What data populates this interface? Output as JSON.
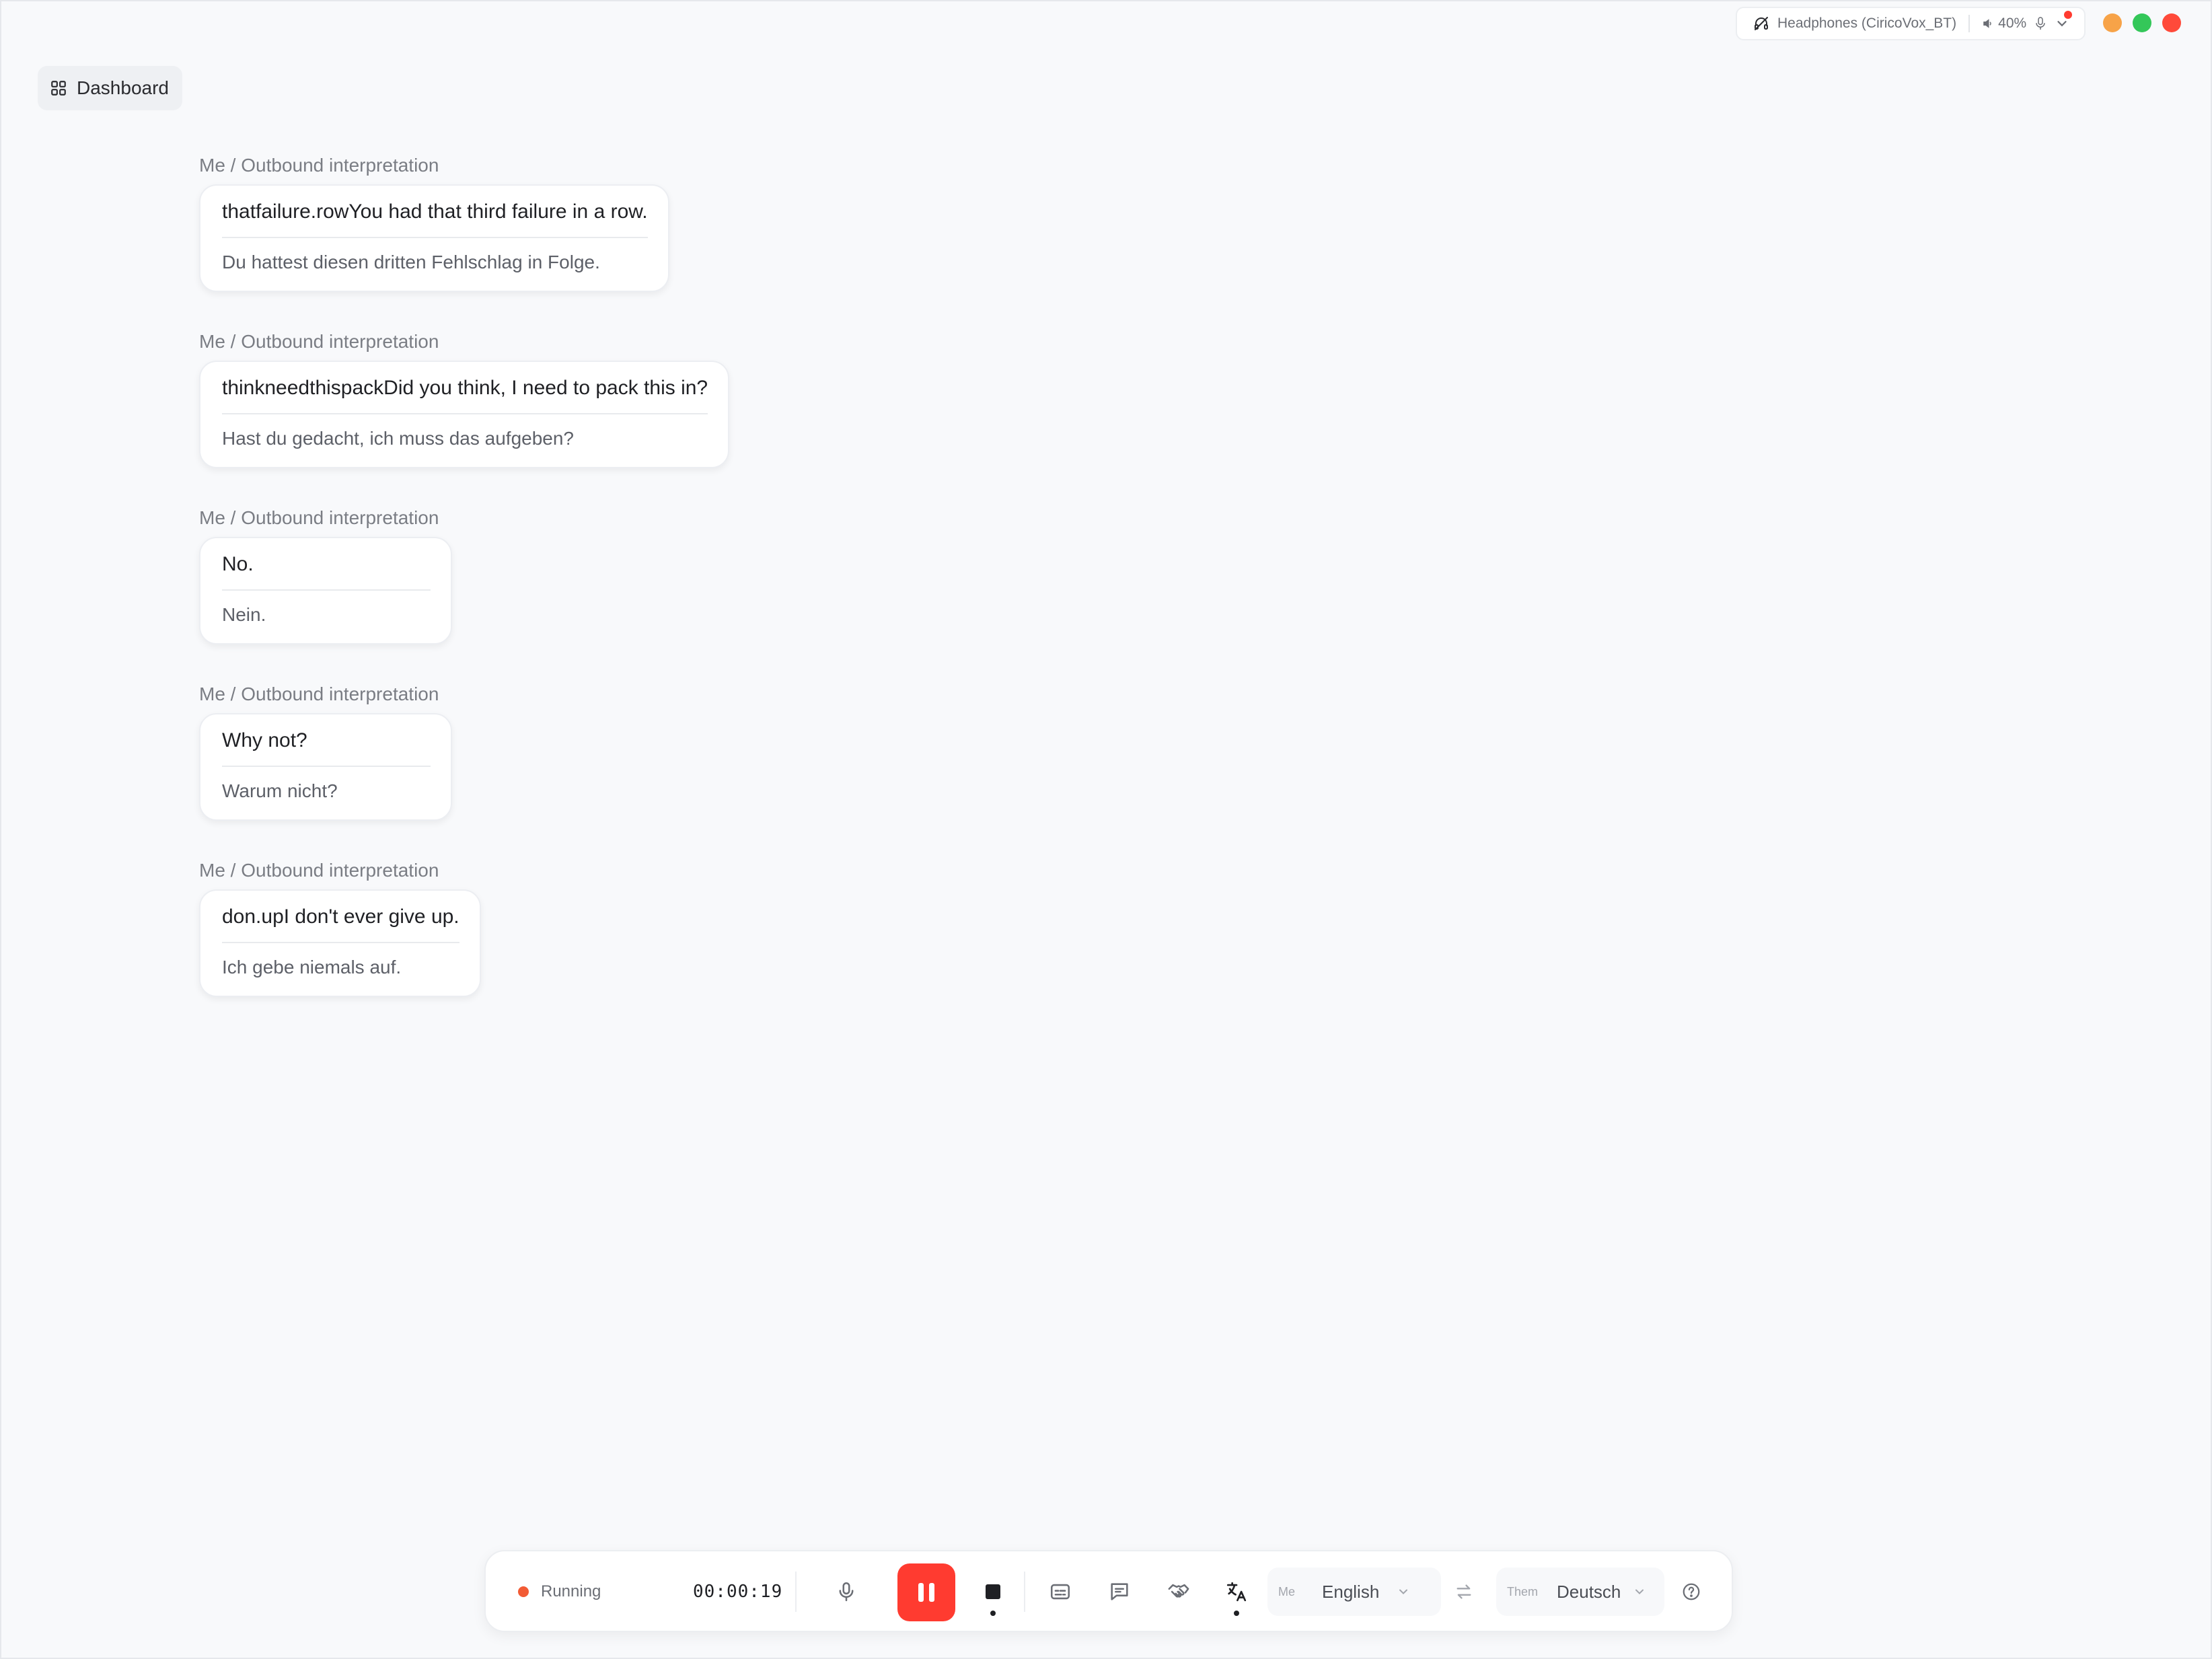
{
  "device": {
    "name": "Headphones (CiricoVox_BT)",
    "volume": "40%"
  },
  "nav": {
    "dashboard_label": "Dashboard"
  },
  "messages": [
    {
      "label": "Me / Outbound interpretation",
      "source": "thatfailure.rowYou had that third failure in a row.",
      "translation": "Du hattest diesen dritten Fehlschlag in Folge."
    },
    {
      "label": "Me / Outbound interpretation",
      "source": "thinkneedthispackDid you think, I need to pack this in?",
      "translation": "Hast du gedacht, ich muss das aufgeben?"
    },
    {
      "label": "Me / Outbound interpretation",
      "source": "No.",
      "translation": "Nein."
    },
    {
      "label": "Me / Outbound interpretation",
      "source": "Why not?",
      "translation": "Warum nicht?"
    },
    {
      "label": "Me / Outbound interpretation",
      "source": "don.upI don't ever give up.",
      "translation": "Ich gebe niemals auf."
    }
  ],
  "controls": {
    "status": "Running",
    "timer": "00:00:19",
    "me_role": "Me",
    "me_language": "English",
    "them_role": "Them",
    "them_language": "Deutsch"
  },
  "colors": {
    "accent_red": "#ff3b30",
    "status_orange": "#f25b35",
    "light_orange": "#f7a348",
    "light_green": "#34c759",
    "light_red": "#ff4a3a"
  },
  "icons": [
    "headphones-icon",
    "speaker-icon",
    "mic-icon",
    "chevron-down-icon",
    "dashboard-grid-icon",
    "pause-icon",
    "stop-icon",
    "captions-icon",
    "chat-icon",
    "handshake-icon",
    "translate-icon",
    "swap-icon",
    "help-icon"
  ]
}
